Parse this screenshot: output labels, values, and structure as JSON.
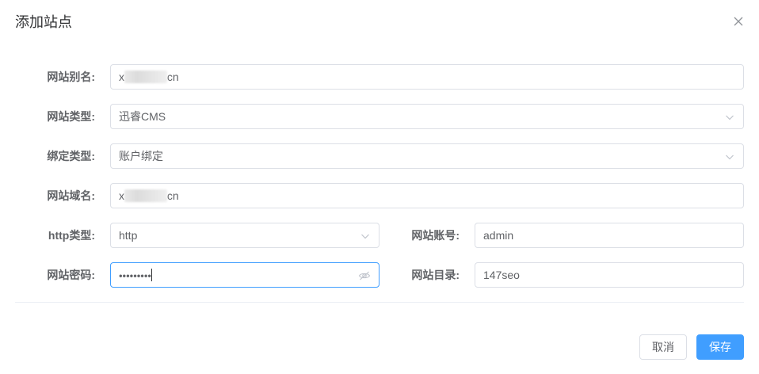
{
  "dialog": {
    "title": "添加站点",
    "close_icon": "close-icon"
  },
  "form": {
    "alias": {
      "label": "网站别名:",
      "value_prefix": "x",
      "value_suffix": ".cn"
    },
    "site_type": {
      "label": "网站类型:",
      "value": "迅睿CMS"
    },
    "bind_type": {
      "label": "绑定类型:",
      "value": "账户绑定"
    },
    "domain": {
      "label": "网站域名:",
      "value_prefix": "x",
      "value_suffix": ".cn"
    },
    "http_type": {
      "label": "http类型:",
      "value": "http"
    },
    "account": {
      "label": "网站账号:",
      "value": "admin"
    },
    "password": {
      "label": "网站密码:",
      "value": "•••••••••",
      "eye_icon": "eye-off-icon"
    },
    "directory": {
      "label": "网站目录:",
      "value": "147seo"
    }
  },
  "footer": {
    "cancel_label": "取消",
    "save_label": "保存"
  },
  "colors": {
    "primary": "#409eff",
    "border": "#dcdfe6",
    "text": "#606266",
    "title": "#303133"
  }
}
